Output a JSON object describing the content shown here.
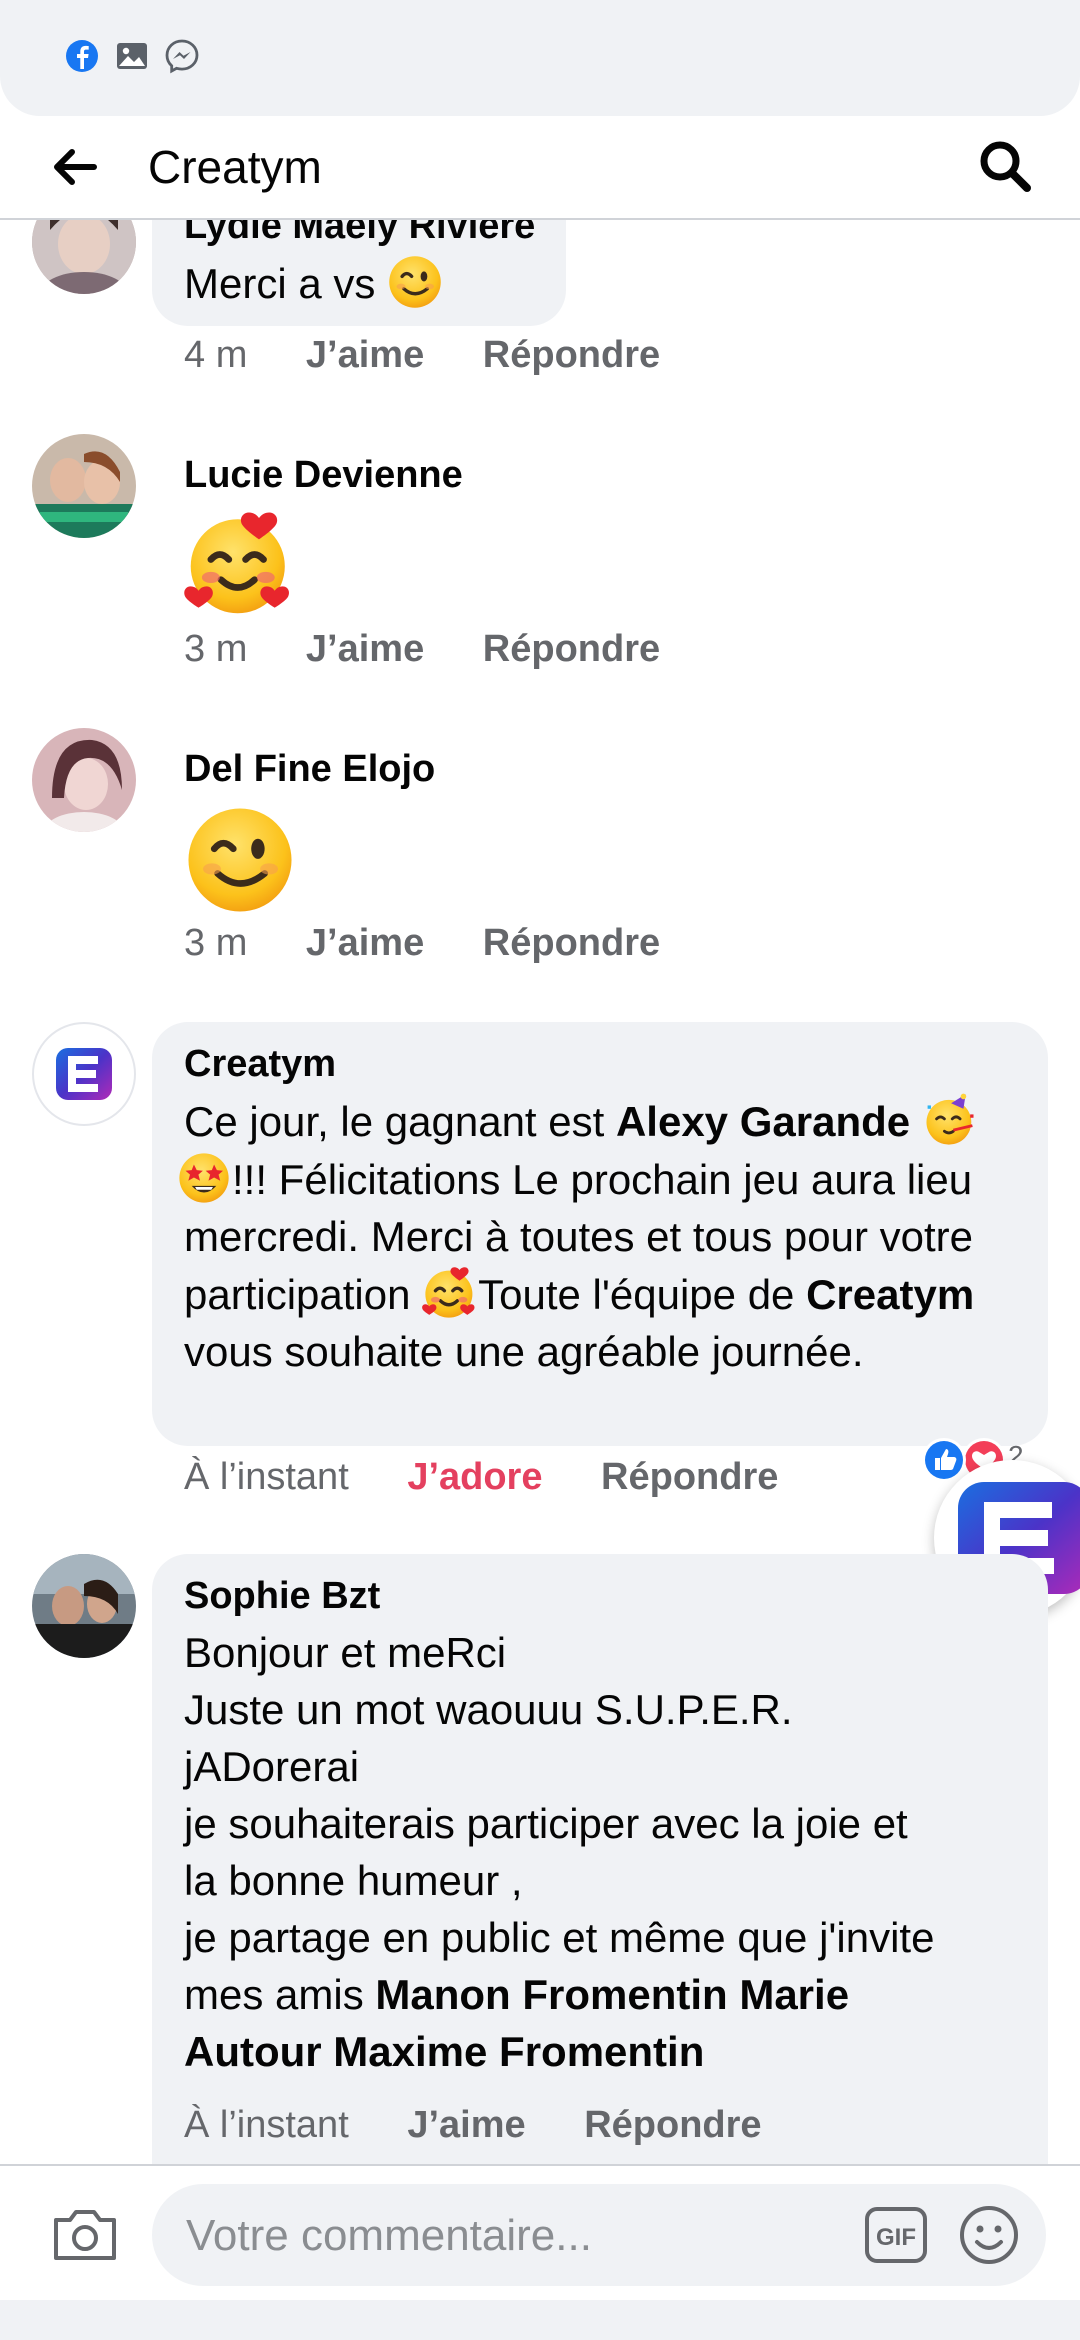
{
  "status_bar": {
    "icons": [
      "facebook-icon",
      "gallery-icon",
      "messenger-icon"
    ]
  },
  "header": {
    "title": "Creatym",
    "back_icon": "arrow-left-icon",
    "search_icon": "search-icon"
  },
  "comments": [
    {
      "author": "Lydie Maëly Rivière",
      "text": "Merci a vs",
      "emoji": "winking-face",
      "time": "4 m",
      "like": "J’aime",
      "reply": "Répondre"
    },
    {
      "author": "Lucie Devienne",
      "emoji": "smiling-face-with-hearts",
      "time": "3 m",
      "like": "J’aime",
      "reply": "Répondre"
    },
    {
      "author": "Del Fine Elojo",
      "emoji": "winking-face",
      "time": "3 m",
      "like": "J’aime",
      "reply": "Répondre"
    },
    {
      "author": "Creatym",
      "text_parts": {
        "p1": "Ce jour, le gagnant est ",
        "b1": "Alexy Garande",
        "p2": "!!! Félicitations Le prochain jeu aura lieu mercredi. Merci à toutes et tous pour votre participation ",
        "p3": "Toute l'équipe de ",
        "b2": "Creatym",
        "p4": " vous souhaite une agréable journée."
      },
      "time": "À l’instant",
      "reaction": "J’adore",
      "reply": "Répondre",
      "reactions_count": "2"
    },
    {
      "author": "Sophie Bzt",
      "lines": [
        "Bonjour et meRci",
        "Juste un mot waouuu S.U.P.E.R.",
        "jADorerai",
        "je souhaiterais participer avec la joie et",
        "la bonne humeur ,",
        "je partage en public et même que j'invite"
      ],
      "last_prefix": "mes amis ",
      "mentions_1": "Manon Fromentin Marie",
      "mentions_2": "Autour Maxime Fromentin",
      "time": "À l’instant",
      "like": "J’aime",
      "reply": "Répondre"
    }
  ],
  "composer": {
    "placeholder": "Votre commentaire...",
    "gif": "GIF"
  },
  "colors": {
    "accent": "#1877f2",
    "love": "#e4405f",
    "bubble": "#f0f2f5",
    "meta": "#65676b",
    "brand_purple": "#6a2bb0"
  }
}
